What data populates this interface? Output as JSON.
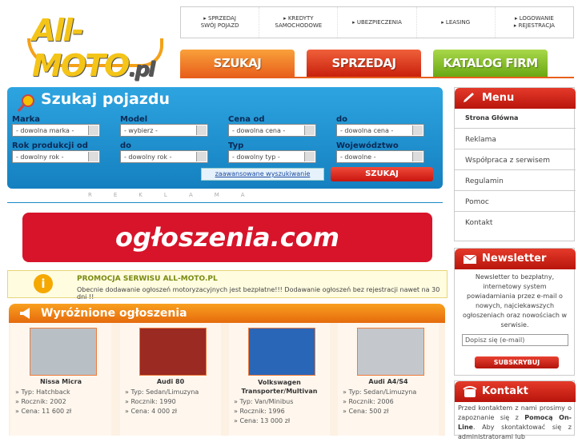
{
  "logo": {
    "brand": "All-MOTO",
    "suffix": ".pl"
  },
  "top_nav": [
    {
      "line1": "▸ SPRZEDAJ",
      "line2": "SWÓJ POJAZD"
    },
    {
      "line1": "▸ KREDYTY",
      "line2": "SAMOCHODOWE"
    },
    {
      "line1": "▸ UBEZPIECZENIA",
      "line2": ""
    },
    {
      "line1": "▸ LEASING",
      "line2": ""
    },
    {
      "line1": "▸ LOGOWANIE",
      "line2": "▸ REJESTRACJA"
    }
  ],
  "tabs": {
    "search": "SZUKAJ",
    "sell": "SPRZEDAJ",
    "catalog": "KATALOG FIRM"
  },
  "colors": {
    "tab_search": "#f07a1a",
    "tab_sell": "#e0381a",
    "tab_catalog": "#7cbc1a",
    "search_bg": "#1a89c8"
  },
  "search": {
    "title": "Szukaj pojazdu",
    "make_label": "Marka",
    "make_value": "- dowolna marka -",
    "model_label": "Model",
    "model_value": "- wybierz -",
    "price_from_label": "Cena od",
    "price_from_value": "- dowolna cena -",
    "price_to_label": "do",
    "price_to_value": "- dowolna cena -",
    "year_from_label": "Rok produkcji od",
    "year_from_value": "- dowolny rok -",
    "year_to_label": "do",
    "year_to_value": "- dowolny rok -",
    "type_label": "Typ",
    "type_value": "- dowolny typ -",
    "region_label": "Województwo",
    "region_value": "- dowolne -",
    "advanced": "zaawansowane wyszukiwanie",
    "submit": "SZUKAJ"
  },
  "reklama": "REKLAMA",
  "banner": {
    "text": "ogłoszenia.com"
  },
  "promo": {
    "title": "PROMOCJA SERWISU ALL-MOTO.PL",
    "body": "Obecnie dodawanie ogłoszeń motoryzacyjnych jest bezpłatne!!! Dodawanie ogłoszeń bez rejestracji nawet na 30 dni !!"
  },
  "featured": {
    "title": "Wyróżnione ogłoszenia",
    "items": [
      {
        "name": "Nissa Micra",
        "type": "Hatchback",
        "year": "2002",
        "price": "11 600 zł",
        "photo_color": "#b8c0c6"
      },
      {
        "name": "Audi 80",
        "type": "Sedan/Limuzyna",
        "year": "1990",
        "price": "4 000 zł",
        "photo_color": "#9a2a22"
      },
      {
        "name": "Volkswagen Transporter/Multivan",
        "type": "Van/Minibus",
        "year": "1996",
        "price": "13 000 zł",
        "photo_color": "#2a66b8"
      },
      {
        "name": "Audi A4/S4",
        "type": "Sedan/Limuzyna",
        "year": "2006",
        "price": "500 zł",
        "photo_color": "#c4c8cc"
      }
    ],
    "labels": {
      "type": "» Typ: ",
      "year": "» Rocznik: ",
      "price": "» Cena: "
    }
  },
  "menu": {
    "title": "Menu",
    "items": [
      "Strona Główna",
      "Reklama",
      "Współpraca z serwisem",
      "Regulamin",
      "Pomoc",
      "Kontakt"
    ]
  },
  "newsletter": {
    "title": "Newsletter",
    "text": "Newsletter to bezpłatny, internetowy system powiadamiania przez e-mail o nowych, najciekawszych ogłoszeniach oraz nowościach w serwisie.",
    "placeholder": "Dopisz się (e-mail)",
    "button": "SUBSKRYBUJ"
  },
  "contact": {
    "title": "Kontakt",
    "text_a": "Przed kontaktem z nami prosimy o zapoznanie się z ",
    "text_b": "Pomocą On-Line",
    "text_c": ". Aby skontaktować się z administratorami lub"
  }
}
